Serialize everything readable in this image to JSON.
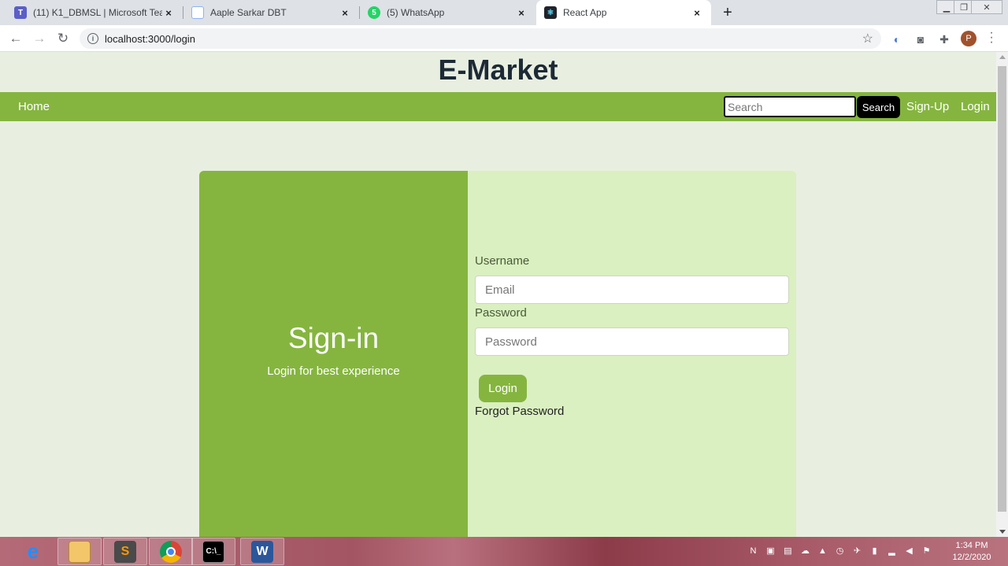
{
  "browser": {
    "tabs": [
      {
        "title": "(11) K1_DBMSL | Microsoft Teams",
        "icon": "teams-icon",
        "active": false
      },
      {
        "title": "Aaple Sarkar DBT",
        "icon": "document-icon",
        "active": false
      },
      {
        "title": "(5) WhatsApp",
        "icon": "whatsapp-icon",
        "active": false
      },
      {
        "title": "React App",
        "icon": "react-icon",
        "active": true
      }
    ],
    "close_glyph": "×",
    "new_tab_glyph": "+",
    "url": "localhost:3000/login",
    "profile_initial": "P"
  },
  "page": {
    "brand": "E-Market",
    "nav": {
      "home": "Home",
      "search_placeholder": "Search",
      "search_button": "Search",
      "signup": "Sign-Up",
      "login": "Login"
    },
    "card": {
      "heading": "Sign-in",
      "subheading": "Login for best experience",
      "username_label": "Username",
      "username_placeholder": "Email",
      "password_label": "Password",
      "password_placeholder": "Password",
      "login_button": "Login",
      "forgot_link": "Forgot Password"
    }
  },
  "taskbar": {
    "apps": [
      "internet-explorer",
      "file-explorer",
      "sublime-text",
      "chrome",
      "command-prompt",
      "word"
    ],
    "time": "1:34 PM",
    "date": "12/2/2020"
  },
  "colors": {
    "accent_green": "#85b53f",
    "card_panel": "#daf0c0",
    "page_bg": "#e8efe1"
  }
}
